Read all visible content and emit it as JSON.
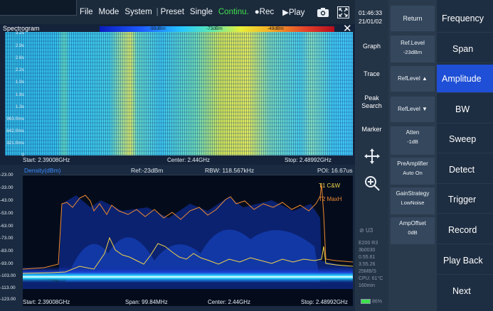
{
  "menu": {
    "items": [
      "File",
      "Mode",
      "System",
      "Preset",
      "Single",
      "Continu.",
      "Rec",
      "Play"
    ],
    "rec_label": "Rec",
    "play_label": "Play"
  },
  "spectrogram": {
    "title": "Spectrogram",
    "colorbar_labels": [
      "-98dBm",
      "-73dBm",
      "-48dBm"
    ],
    "y_ticks": [
      "3.2s",
      "2.9s",
      "2.6s",
      "2.2s",
      "1.9s",
      "1.6s",
      "1.3s",
      "963.0ms",
      "642.0ms",
      "321.0ms",
      "0"
    ],
    "start": "Start: 2.39008GHz",
    "center": "Center: 2.44GHz",
    "stop": "Stop: 2.48992GHz"
  },
  "density": {
    "title": "Density(dBm)",
    "ref": "Ref:-23dBm",
    "rbw": "RBW: 118.567kHz",
    "poi": "POI: 16.67us",
    "y_ticks": [
      "-23.00",
      "-33.00",
      "-43.00",
      "-53.00",
      "-63.00",
      "-73.00",
      "-83.00",
      "-93.00",
      "-103.00",
      "-113.00",
      "-123.00"
    ],
    "trace1": "T1  C&W",
    "trace2": "T2  MaxH",
    "start": "Start: 2.39008GHz",
    "span": "Span: 99.84MHz",
    "center": "Center: 2.44GHz",
    "stop": "Stop: 2.48992GHz"
  },
  "status": {
    "time": "01:46:33",
    "date": "21/01/02",
    "buttons": [
      "Graph",
      "Trace",
      "Peak Search",
      "Marker"
    ],
    "usb": "U3",
    "sysinfo": [
      "E200 R3",
      "3b0030",
      "0.55.61",
      "3.55.26",
      "25MB/S",
      "CPU: 61°C",
      "160min"
    ],
    "battery": "86%"
  },
  "softkeys": {
    "return": "Return",
    "ref_level": "Ref.Level",
    "ref_level_value": "-23dBm",
    "ref_up": "RefLevel ▲",
    "ref_down": "RefLevel ▼",
    "atten": "Atten",
    "atten_value": "-1dB",
    "preamp": "PreAmplifier",
    "preamp_value": "Auto On",
    "gain": "GainStrategy",
    "gain_value": "LowNoise",
    "ampoffset": "AmpOffset",
    "ampoffset_value": "0dB"
  },
  "main_menu": [
    "Frequency",
    "Span",
    "Amplitude",
    "BW",
    "Sweep",
    "Detect",
    "Trigger",
    "Record",
    "Play Back",
    "Next"
  ],
  "colors": {
    "accent": "#1e4fd6",
    "continu": "#3fe04d",
    "trace1": "#f0d24a",
    "trace2": "#f08a30"
  }
}
